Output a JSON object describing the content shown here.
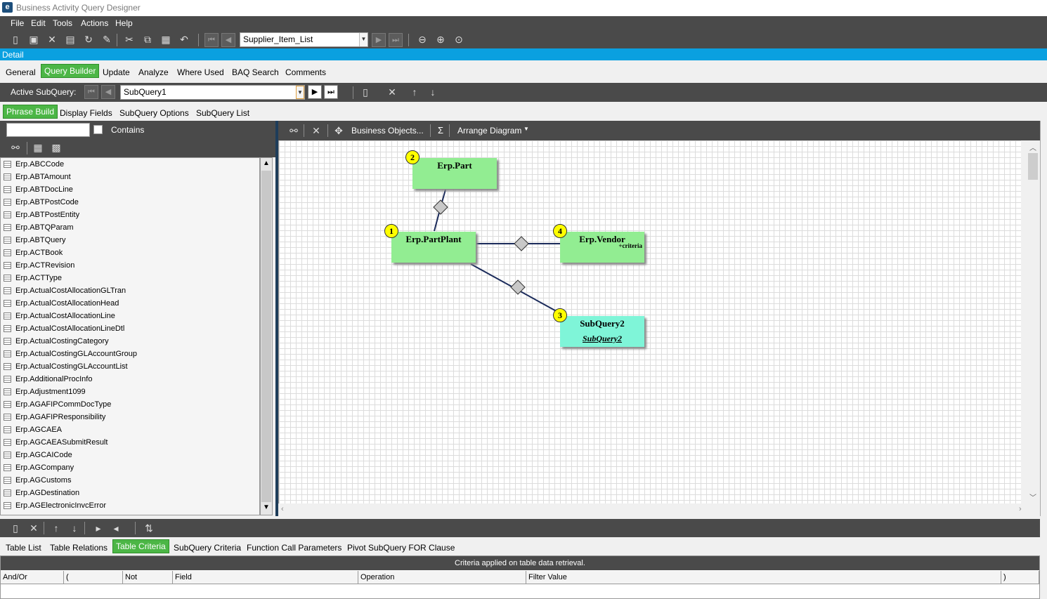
{
  "window": {
    "title": "Business Activity Query Designer"
  },
  "menu": [
    "File",
    "Edit",
    "Tools",
    "Actions",
    "Help"
  ],
  "toolbar": {
    "record_combo": "Supplier_Item_List"
  },
  "detail_bar": "Detail",
  "main_tabs": [
    {
      "label": "General",
      "active": false
    },
    {
      "label": "Query Builder",
      "active": true
    },
    {
      "label": "Update",
      "active": false
    },
    {
      "label": "Analyze",
      "active": false
    },
    {
      "label": "Where Used",
      "active": false
    },
    {
      "label": "BAQ Search",
      "active": false
    },
    {
      "label": "Comments",
      "active": false
    }
  ],
  "subquery_bar": {
    "label": "Active SubQuery:",
    "value": "SubQuery1"
  },
  "sub_tabs": [
    {
      "label": "Phrase Build",
      "active": true
    },
    {
      "label": "Display Fields",
      "active": false
    },
    {
      "label": "SubQuery Options",
      "active": false
    },
    {
      "label": "SubQuery List",
      "active": false
    }
  ],
  "search": {
    "value": "",
    "contains_label": "Contains"
  },
  "table_list": [
    "Erp.ABCCode",
    "Erp.ABTAmount",
    "Erp.ABTDocLine",
    "Erp.ABTPostCode",
    "Erp.ABTPostEntity",
    "Erp.ABTQParam",
    "Erp.ABTQuery",
    "Erp.ACTBook",
    "Erp.ACTRevision",
    "Erp.ACTType",
    "Erp.ActualCostAllocationGLTran",
    "Erp.ActualCostAllocationHead",
    "Erp.ActualCostAllocationLine",
    "Erp.ActualCostAllocationLineDtl",
    "Erp.ActualCostingCategory",
    "Erp.ActualCostingGLAccountGroup",
    "Erp.ActualCostingGLAccountList",
    "Erp.AdditionalProcInfo",
    "Erp.Adjustment1099",
    "Erp.AGAFIPCommDocType",
    "Erp.AGAFIPResponsibility",
    "Erp.AGCAEA",
    "Erp.AGCAEASubmitResult",
    "Erp.AGCAICode",
    "Erp.AGCompany",
    "Erp.AGCustoms",
    "Erp.AGDestination",
    "Erp.AGElectronicInvcError"
  ],
  "canvas_toolbar": {
    "business_objects": "Business Objects...",
    "sigma": "Σ",
    "arrange": "Arrange Diagram"
  },
  "diagram": {
    "nodes": [
      {
        "num": "2",
        "name": "Erp.Part",
        "criteria": "",
        "sub": ""
      },
      {
        "num": "1",
        "name": "Erp.PartPlant",
        "criteria": "",
        "sub": ""
      },
      {
        "num": "4",
        "name": "Erp.Vendor",
        "criteria": "+criteria",
        "sub": ""
      },
      {
        "num": "3",
        "name": "SubQuery2",
        "criteria": "",
        "sub": "SubQuery2"
      }
    ]
  },
  "bottom_tabs": [
    {
      "label": "Table List",
      "active": false
    },
    {
      "label": "Table Relations",
      "active": false
    },
    {
      "label": "Table Criteria",
      "active": true
    },
    {
      "label": "SubQuery Criteria",
      "active": false
    },
    {
      "label": "Function Call Parameters",
      "active": false
    },
    {
      "label": "Pivot SubQuery FOR Clause",
      "active": false
    }
  ],
  "criteria_grid": {
    "caption": "Criteria applied on  table data retrieval.",
    "columns": [
      "And/Or",
      "(",
      "Not",
      "Field",
      "Operation",
      "Filter Value",
      ")"
    ]
  },
  "colors": {
    "accent_green": "#4cb646",
    "detail_blue": "#0aa0e0",
    "dark_bar": "#4a4a4a",
    "table_node": "#92ed92",
    "subquery_node": "#7ff5d8"
  }
}
